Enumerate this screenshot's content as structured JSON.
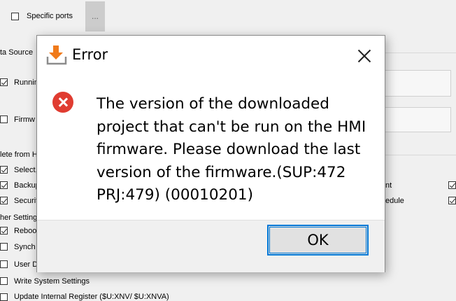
{
  "background": {
    "specific_ports_label": "Specific ports",
    "ellipsis_label": "...",
    "data_source_header": "ta Source",
    "running_label": "Runnin",
    "firmware_label": "Firmw",
    "delete_header": "lete from H",
    "select_label": "Select,",
    "backup_label": "Backup",
    "security_label": "Securit",
    "other_settings_header": "her Setting",
    "reboot_label": "Reboo",
    "synch_label": "Synch",
    "user_label": "User D",
    "write_system_settings_label": "Write System Settings",
    "update_register_label": "Update Internal Register ($U:XNV/ $U:XNVA)",
    "right_label_1": "nt",
    "right_label_2": "edule"
  },
  "dialog": {
    "title": "Error",
    "message": "The version of the downloaded project that can't be run on the HMI firmware. Please download the last version of the firmware.(SUP:472 PRJ:479) (00010201)",
    "ok_label": "OK"
  },
  "colors": {
    "error_icon": "#e03c31",
    "accent": "#0078d7",
    "download_icon": "#f07a1a"
  }
}
